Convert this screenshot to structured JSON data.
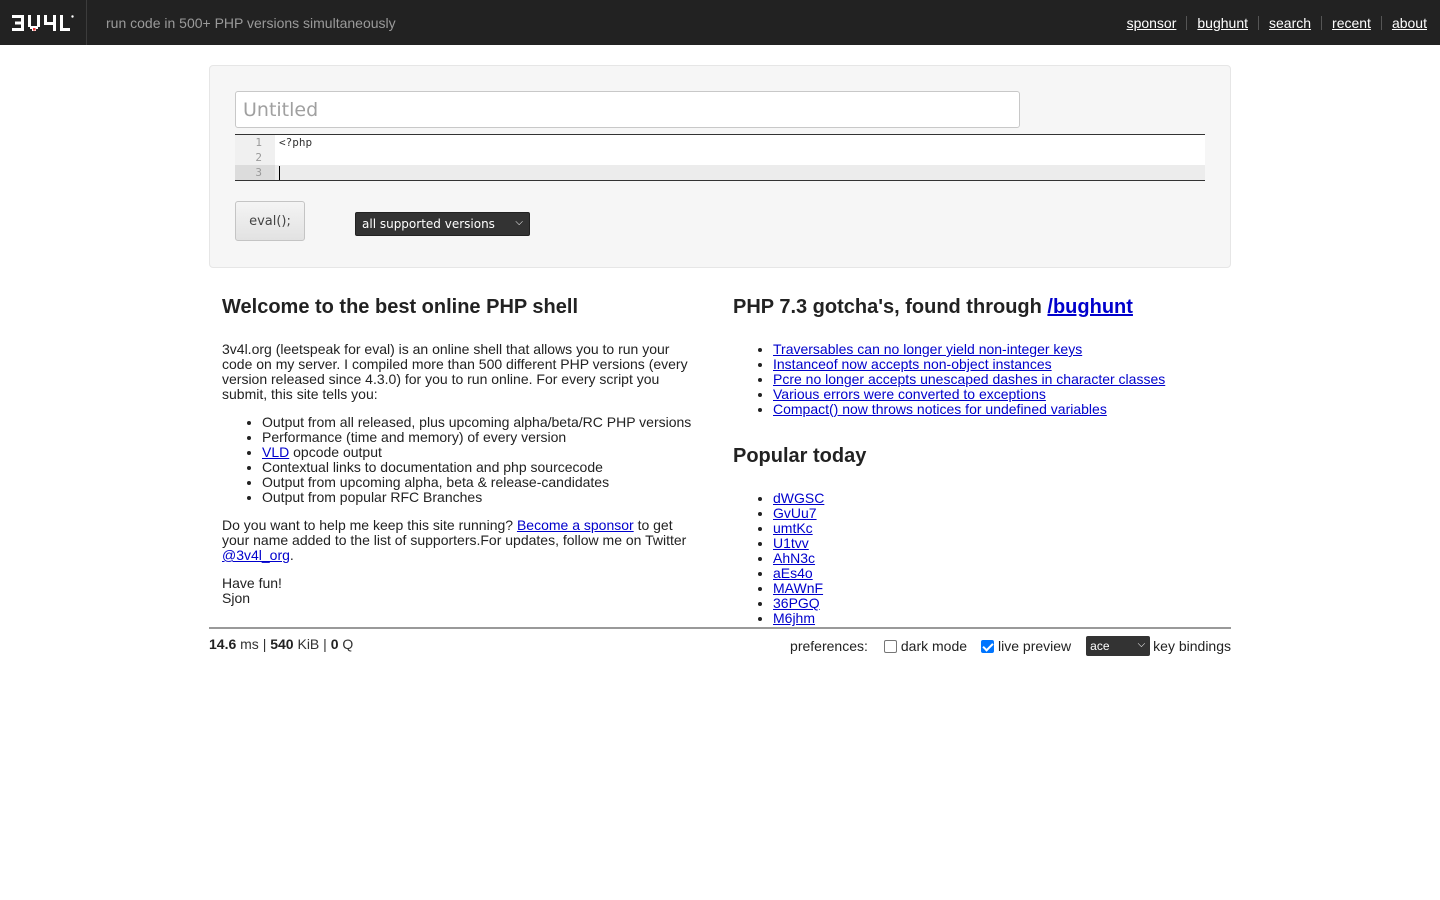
{
  "header": {
    "logo_text": "3V4L",
    "tagline": "run code in 500+ PHP versions simultaneously",
    "nav": [
      "sponsor",
      "bughunt",
      "search",
      "recent",
      "about"
    ]
  },
  "editor": {
    "title_placeholder": "Untitled",
    "title_value": "",
    "line_numbers": [
      "1",
      "2",
      "3"
    ],
    "lines": [
      "<?php",
      "",
      ""
    ],
    "eval_label": "eval();",
    "version_select": "all supported versions"
  },
  "welcome": {
    "heading": "Welcome to the best online PHP shell",
    "intro": "3v4l.org (leetspeak for eval) is an online shell that allows you to run your code on my server. I compiled more than 500 different PHP versions (every version released since 4.3.0) for you to run online. For every script you submit, this site tells you:",
    "features": [
      "Output from all released, plus upcoming alpha/beta/RC PHP versions",
      "Performance (time and memory) of every version",
      "opcode output",
      "Contextual links to documentation and php sourcecode",
      "Output from upcoming alpha, beta & release-candidates",
      "Output from popular RFC Branches"
    ],
    "vld_link": "VLD",
    "sponsor_text_1": "Do you want to help me keep this site running?",
    "sponsor_link": "Become a sponsor",
    "sponsor_text_2": "to get your name added to the list of supporters.For updates, follow me on Twitter",
    "twitter_link": "@3v4l_org",
    "sponsor_text_3": ".",
    "have_fun": "Have fun!",
    "signature": "Sjon"
  },
  "gotchas": {
    "heading_prefix": "PHP 7.3 gotcha's, found through",
    "heading_link": "/bughunt",
    "items": [
      "Traversables can no longer yield non-integer keys",
      "Instanceof now accepts non-object instances",
      "Pcre no longer accepts unescaped dashes in character classes",
      "Various errors were converted to exceptions",
      "Compact() now throws notices for undefined variables"
    ]
  },
  "popular": {
    "heading": "Popular today",
    "items": [
      "dWGSC",
      "GvUu7",
      "umtKc",
      "U1tvv",
      "AhN3c",
      "aEs4o",
      "MAWnF",
      "36PGQ",
      "M6jhm"
    ]
  },
  "footer": {
    "ms": "14.6",
    "ms_unit": "ms",
    "kib": "540",
    "kib_unit": "KiB",
    "q": "0",
    "q_unit": "Q",
    "sep": "|",
    "prefs_label": "preferences:",
    "dark_mode": "dark mode",
    "dark_mode_checked": false,
    "live_preview": "live preview",
    "live_preview_checked": true,
    "key_bindings_value": "ace",
    "key_bindings_label": "key bindings"
  }
}
